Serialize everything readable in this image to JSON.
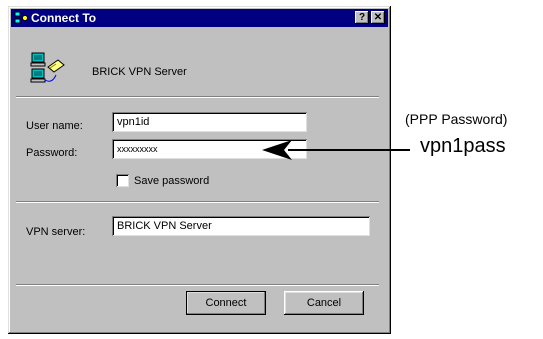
{
  "window": {
    "title": "Connect To"
  },
  "titlebar_buttons": {
    "help": "?",
    "close": "✕"
  },
  "connection": {
    "name": "BRICK VPN Server"
  },
  "form": {
    "username_label": "User name:",
    "username_value": "vpn1id",
    "password_label": "Password:",
    "password_value": "xxxxxxxxx",
    "save_password_label": "Save password",
    "vpn_server_label": "VPN server:",
    "vpn_server_value": "BRICK VPN Server"
  },
  "buttons": {
    "connect": "Connect",
    "cancel": "Cancel"
  },
  "annotation": {
    "caption": "(PPP Password)",
    "value": "vpn1pass"
  },
  "colors": {
    "titlebar": "#000080",
    "dialog": "#c0c0c0"
  }
}
